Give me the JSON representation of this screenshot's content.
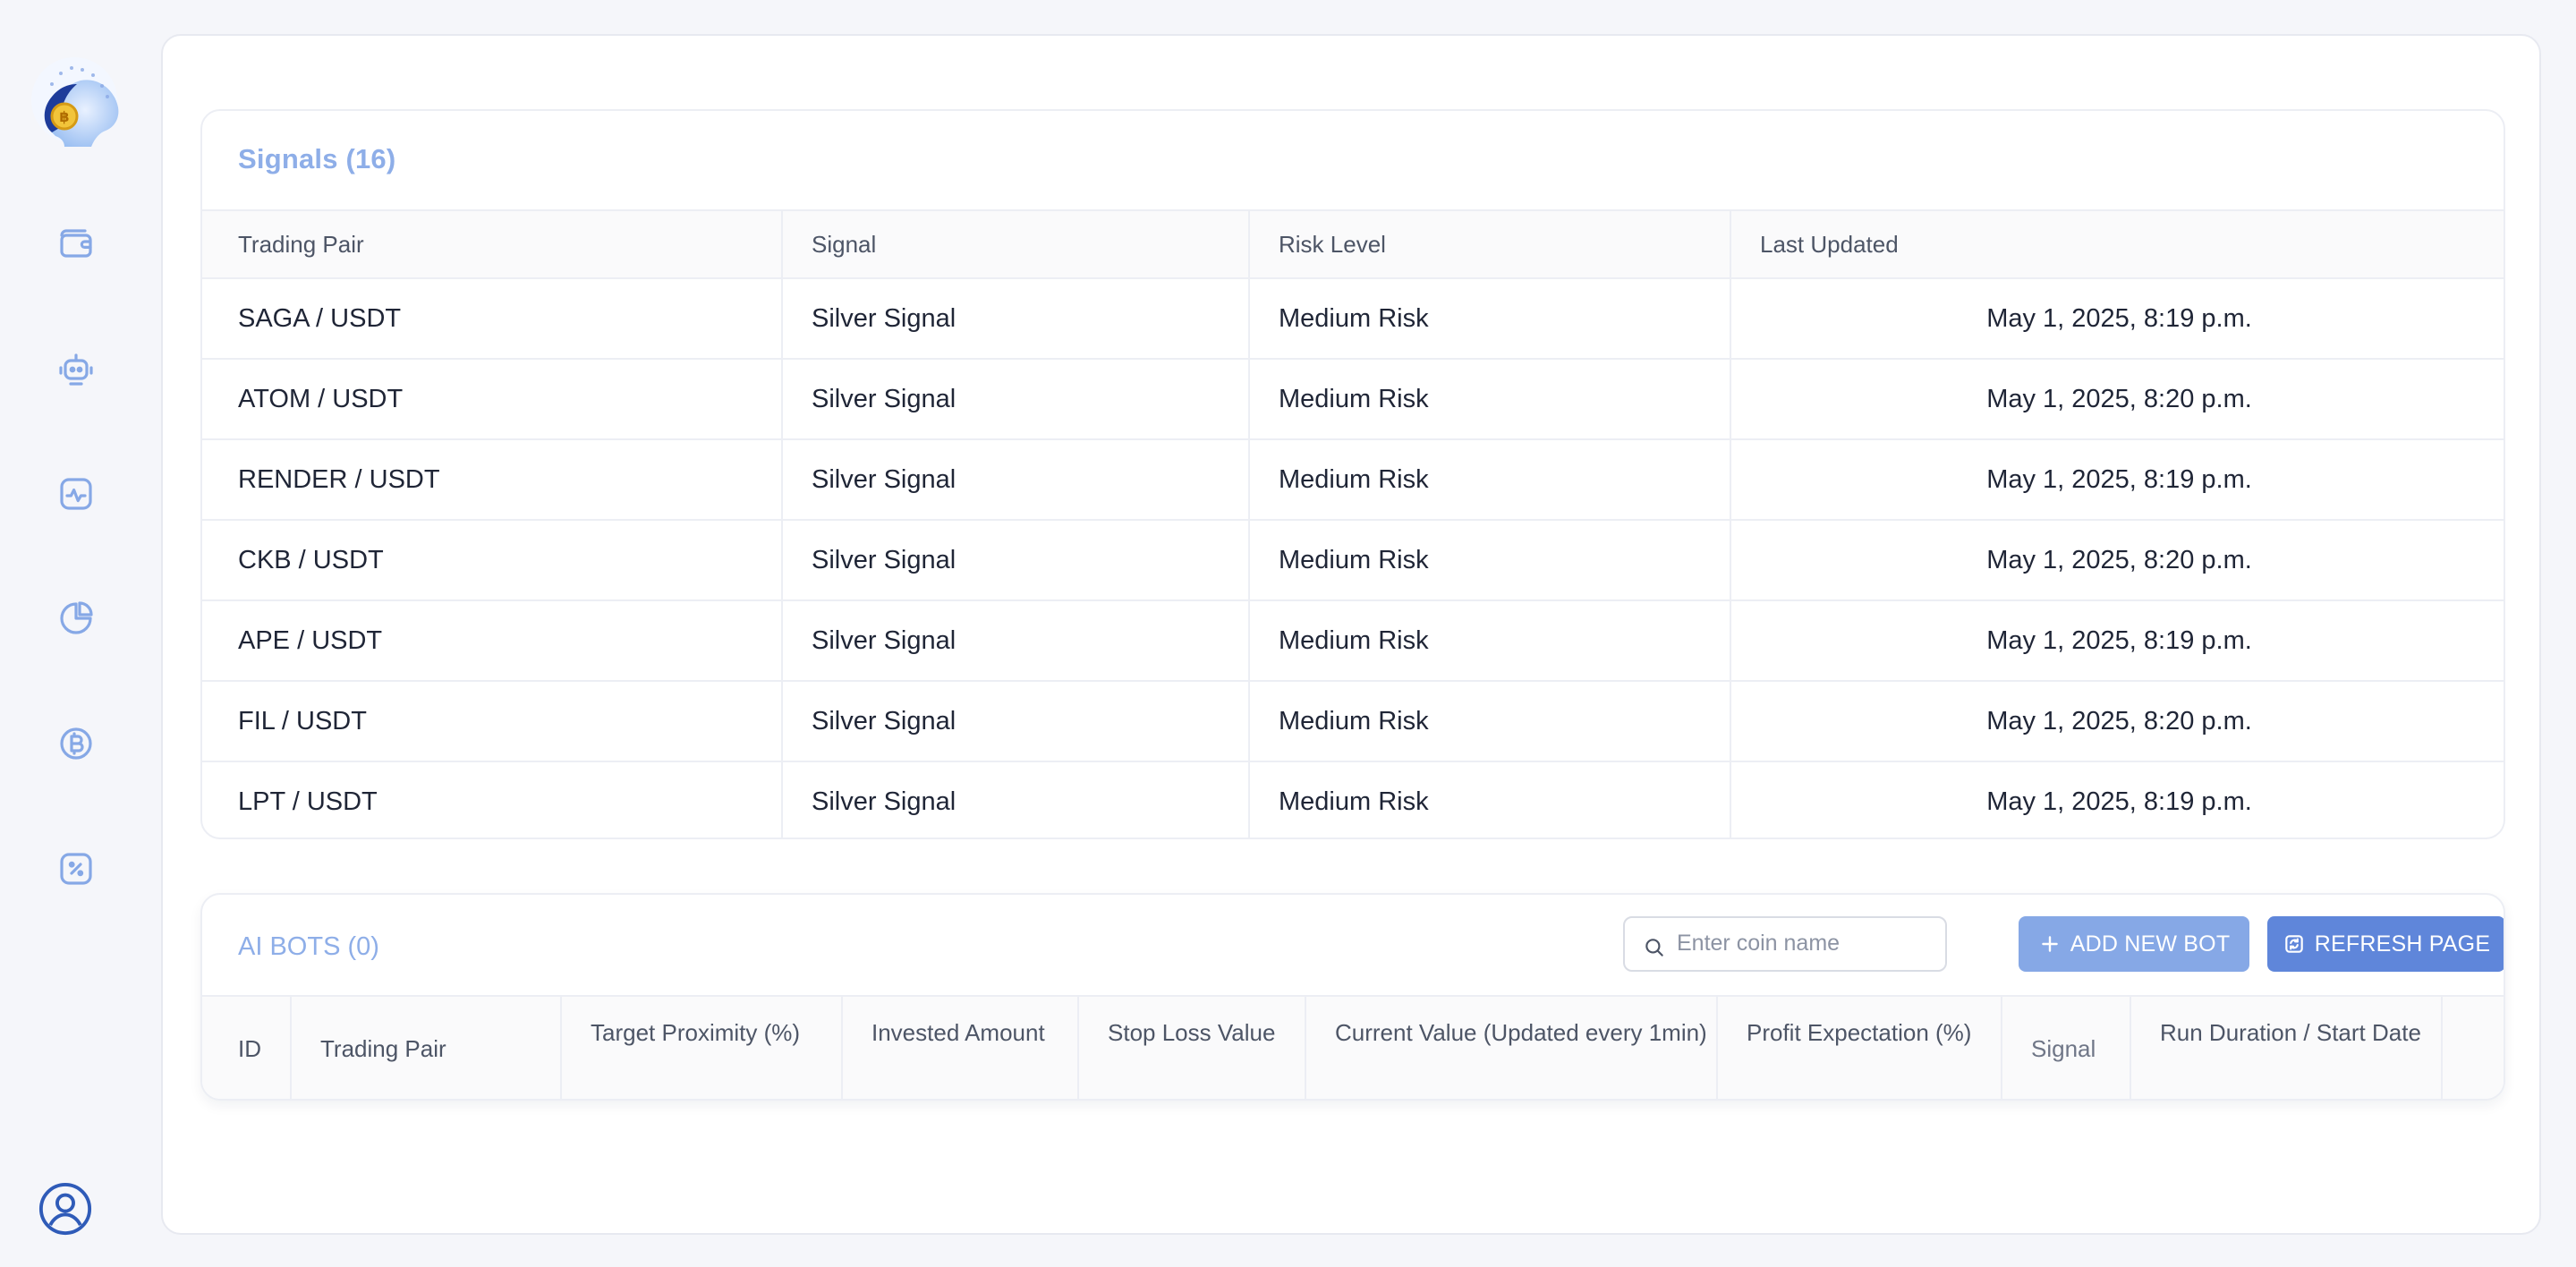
{
  "colors": {
    "accent": "#8EAEE8",
    "primary_button": "#5F86DA",
    "secondary_button": "#86A8E6"
  },
  "sidebar": {
    "logo_icon": "ai-head-bitcoin-logo",
    "items": [
      {
        "name": "wallet",
        "icon": "wallet-icon"
      },
      {
        "name": "bots",
        "icon": "robot-icon"
      },
      {
        "name": "activity",
        "icon": "activity-chart-icon"
      },
      {
        "name": "analytics",
        "icon": "pie-chart-icon"
      },
      {
        "name": "crypto",
        "icon": "bitcoin-icon"
      },
      {
        "name": "discount",
        "icon": "percent-badge-icon"
      }
    ],
    "profile_icon": "user-circle-icon"
  },
  "signals": {
    "title": "Signals (16)",
    "columns": [
      "Trading Pair",
      "Signal",
      "Risk Level",
      "Last Updated"
    ],
    "rows": [
      [
        "SAGA / USDT",
        "Silver Signal",
        "Medium Risk",
        "May 1, 2025, 8:19 p.m."
      ],
      [
        "ATOM / USDT",
        "Silver Signal",
        "Medium Risk",
        "May 1, 2025, 8:20 p.m."
      ],
      [
        "RENDER / USDT",
        "Silver Signal",
        "Medium Risk",
        "May 1, 2025, 8:19 p.m."
      ],
      [
        "CKB / USDT",
        "Silver Signal",
        "Medium Risk",
        "May 1, 2025, 8:20 p.m."
      ],
      [
        "APE / USDT",
        "Silver Signal",
        "Medium Risk",
        "May 1, 2025, 8:19 p.m."
      ],
      [
        "FIL / USDT",
        "Silver Signal",
        "Medium Risk",
        "May 1, 2025, 8:20 p.m."
      ],
      [
        "LPT / USDT",
        "Silver Signal",
        "Medium Risk",
        "May 1, 2025, 8:19 p.m."
      ]
    ]
  },
  "bots": {
    "title": "AI BOTS (0)",
    "search": {
      "placeholder": "Enter coin name",
      "value": "",
      "icon": "search-icon"
    },
    "add_button": {
      "label": "ADD NEW BOT",
      "icon": "plus-icon"
    },
    "refresh_button": {
      "label": "REFRESH PAGE",
      "icon": "refresh-icon"
    },
    "columns": [
      "ID",
      "Trading Pair",
      "Target Proximity (%)",
      "Invested Amount",
      "Stop Loss Value",
      "Current Value (Updated every 1min)",
      "Profit Expectation (%)",
      "Signal",
      "Run Duration / Start Date",
      ""
    ]
  }
}
